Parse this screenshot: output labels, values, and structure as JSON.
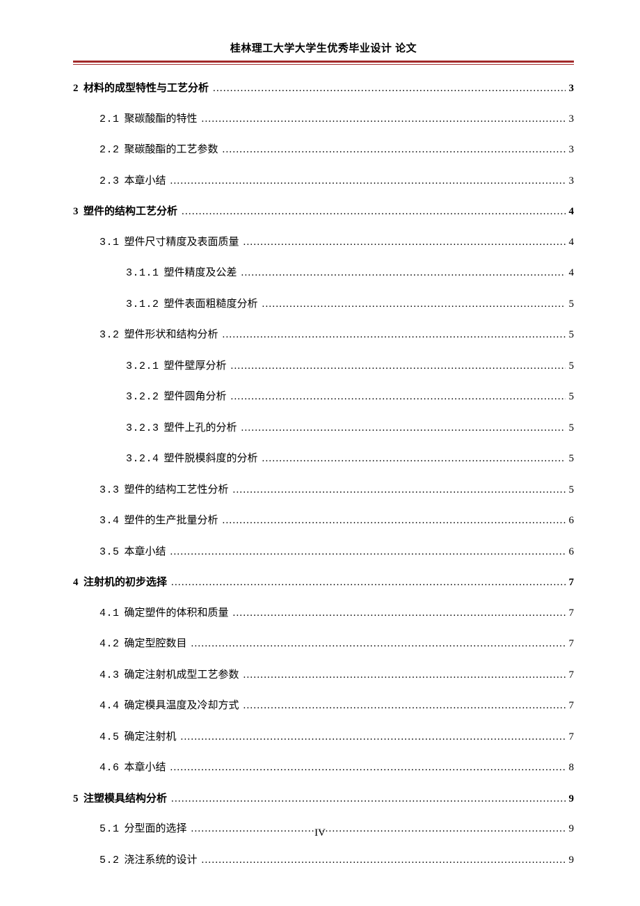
{
  "header": {
    "title": "桂林理工大学大学生优秀毕业设计 论文"
  },
  "toc": [
    {
      "level": 1,
      "num": "2",
      "title": "材料的成型特性与工艺分析",
      "page": "3"
    },
    {
      "level": 2,
      "num": "2.1",
      "title": "聚碳酸酯的特性",
      "page": "3"
    },
    {
      "level": 2,
      "num": "2.2",
      "title": "聚碳酸酯的工艺参数",
      "page": "3"
    },
    {
      "level": 2,
      "num": "2.3",
      "title": "本章小结",
      "page": "3"
    },
    {
      "level": 1,
      "num": "3",
      "title": "塑件的结构工艺分析",
      "page": "4"
    },
    {
      "level": 2,
      "num": "3.1",
      "title": "塑件尺寸精度及表面质量",
      "page": "4"
    },
    {
      "level": 3,
      "num": "3.1.1",
      "title": "塑件精度及公差",
      "page": "4"
    },
    {
      "level": 3,
      "num": "3.1.2",
      "title": "塑件表面粗糙度分析",
      "page": "5"
    },
    {
      "level": 2,
      "num": "3.2",
      "title": "塑件形状和结构分析",
      "page": "5"
    },
    {
      "level": 3,
      "num": "3.2.1",
      "title": "塑件壁厚分析",
      "page": "5"
    },
    {
      "level": 3,
      "num": "3.2.2",
      "title": "塑件圆角分析",
      "page": "5"
    },
    {
      "level": 3,
      "num": "3.2.3",
      "title": "塑件上孔的分析",
      "page": "5"
    },
    {
      "level": 3,
      "num": "3.2.4",
      "title": "塑件脱模斜度的分析",
      "page": "5"
    },
    {
      "level": 2,
      "num": "3.3",
      "title": "塑件的结构工艺性分析",
      "page": "5"
    },
    {
      "level": 2,
      "num": "3.4",
      "title": "塑件的生产批量分析",
      "page": "6"
    },
    {
      "level": 2,
      "num": "3.5",
      "title": "本章小结",
      "page": "6"
    },
    {
      "level": 1,
      "num": "4",
      "title": "注射机的初步选择",
      "page": "7"
    },
    {
      "level": 2,
      "num": "4.1",
      "title": "确定塑件的体积和质量",
      "page": "7"
    },
    {
      "level": 2,
      "num": "4.2",
      "title": "确定型腔数目",
      "page": "7"
    },
    {
      "level": 2,
      "num": "4.3",
      "title": "确定注射机成型工艺参数",
      "page": "7"
    },
    {
      "level": 2,
      "num": "4.4",
      "title": "确定模具温度及冷却方式",
      "page": "7"
    },
    {
      "level": 2,
      "num": "4.5",
      "title": "确定注射机",
      "page": "7"
    },
    {
      "level": 2,
      "num": "4.6",
      "title": "本章小结",
      "page": "8"
    },
    {
      "level": 1,
      "num": "5",
      "title": "注塑模具结构分析",
      "page": "9"
    },
    {
      "level": 2,
      "num": "5.1",
      "title": "分型面的选择",
      "page": "9"
    },
    {
      "level": 2,
      "num": "5.2",
      "title": "浇注系统的设计",
      "page": "9"
    }
  ],
  "footer": {
    "page_label": "IV"
  }
}
